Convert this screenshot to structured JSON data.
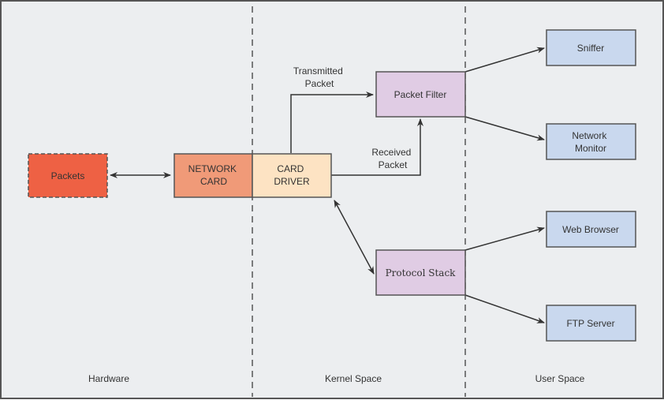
{
  "diagram": {
    "colors": {
      "background": "#eceef0",
      "frame": "#555555",
      "divider": "#555555",
      "arrow": "#333333",
      "packets_fill": "#ee6144",
      "network_card_fill": "#f09a78",
      "card_driver_fill": "#fde3c3",
      "kernel_module_fill": "#e0cce4",
      "user_app_fill": "#c9d8ee",
      "box_stroke": "#555555"
    },
    "zones": {
      "hardware": "Hardware",
      "kernel": "Kernel Space",
      "user": "User Space"
    },
    "nodes": {
      "packets": "Packets",
      "network_card": [
        "NETWORK",
        "CARD"
      ],
      "card_driver": [
        "CARD",
        "DRIVER"
      ],
      "packet_filter": "Packet Filter",
      "protocol_stack": "Protocol Stack",
      "sniffer": "Sniffer",
      "network_monitor": [
        "Network",
        "Monitor"
      ],
      "web_browser": "Web Browser",
      "ftp_server": "FTP Server"
    },
    "edge_labels": {
      "transmitted": [
        "Transmitted",
        "Packet"
      ],
      "received": [
        "Received",
        "Packet"
      ]
    },
    "edges": [
      {
        "from": "packets",
        "to": "network_card",
        "direction": "both"
      },
      {
        "from": "card_driver",
        "to": "packet_filter",
        "label": "transmitted",
        "direction": "forward"
      },
      {
        "from": "card_driver",
        "to": "packet_filter",
        "label": "received",
        "direction": "forward"
      },
      {
        "from": "card_driver",
        "to": "protocol_stack",
        "direction": "both"
      },
      {
        "from": "packet_filter",
        "to": "sniffer",
        "direction": "forward"
      },
      {
        "from": "packet_filter",
        "to": "network_monitor",
        "direction": "forward"
      },
      {
        "from": "protocol_stack",
        "to": "web_browser",
        "direction": "forward"
      },
      {
        "from": "protocol_stack",
        "to": "ftp_server",
        "direction": "forward"
      }
    ]
  }
}
